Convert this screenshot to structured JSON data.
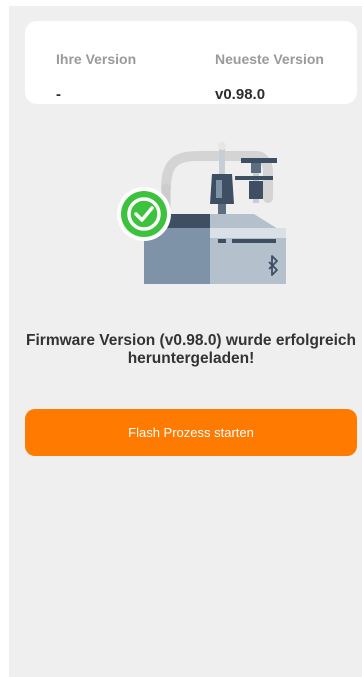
{
  "version_card": {
    "current_label": "Ihre Version",
    "current_value": "-",
    "latest_label": "Neueste Version",
    "latest_value": "v0.98.0"
  },
  "illustration": {
    "icon": "firmware-device-with-check-icon",
    "check_color": "#3cc23c",
    "body_color": "#7f93a8",
    "body_light_color": "#b4c1cd",
    "pipe_color": "#d4d4d4",
    "dark_color": "#3f4f63"
  },
  "message": "Firmware Version (v0.98.0) wurde erfolgreich heruntergeladen!",
  "flash_button": {
    "label": "Flash Prozess starten",
    "color": "#ff7a00"
  }
}
